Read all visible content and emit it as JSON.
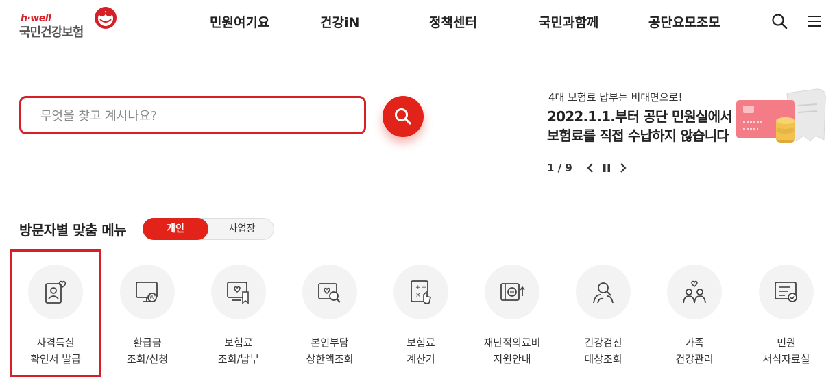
{
  "header": {
    "logo_brand": "h·well",
    "logo_name": "국민건강보험",
    "nav": [
      "민원여기요",
      "건강iN",
      "정책센터",
      "국민과함께",
      "공단요모조모"
    ],
    "search_icon": "search-icon",
    "menu_icon": "hamburger-menu-icon"
  },
  "search": {
    "placeholder": "무엇을 찾고 계시나요?",
    "value": ""
  },
  "banner": {
    "subtitle": "4대 보험료 납부는 비대면으로!",
    "title_line1": "2022.1.1.부터 공단 민원실에서",
    "title_line2": "보험료를 직접 수납하지 않습니다",
    "pager": "1 / 9"
  },
  "visitor_menu": {
    "title": "방문자별 맞춤 메뉴",
    "toggle": {
      "active": "개인",
      "inactive": "사업장"
    },
    "items": [
      {
        "line1": "자격득실",
        "line2": "확인서 발급",
        "icon": "id-card-icon"
      },
      {
        "line1": "환급금",
        "line2": "조회/신청",
        "icon": "monitor-won-icon"
      },
      {
        "line1": "보험료",
        "line2": "조회/납부",
        "icon": "bill-icon"
      },
      {
        "line1": "본인부담",
        "line2": "상한액조회",
        "icon": "heart-search-icon"
      },
      {
        "line1": "보험료",
        "line2": "계산기",
        "icon": "calculator-icon"
      },
      {
        "line1": "재난적의료비",
        "line2": "지원안내",
        "icon": "won-support-icon"
      },
      {
        "line1": "건강검진",
        "line2": "대상조회",
        "icon": "person-search-icon"
      },
      {
        "line1": "가족",
        "line2": "건강관리",
        "icon": "family-heart-icon"
      },
      {
        "line1": "민원",
        "line2": "서식자료실",
        "icon": "document-check-icon"
      }
    ]
  },
  "colors": {
    "accent": "#e2231a",
    "tile_bg": "#f3f3f3"
  }
}
